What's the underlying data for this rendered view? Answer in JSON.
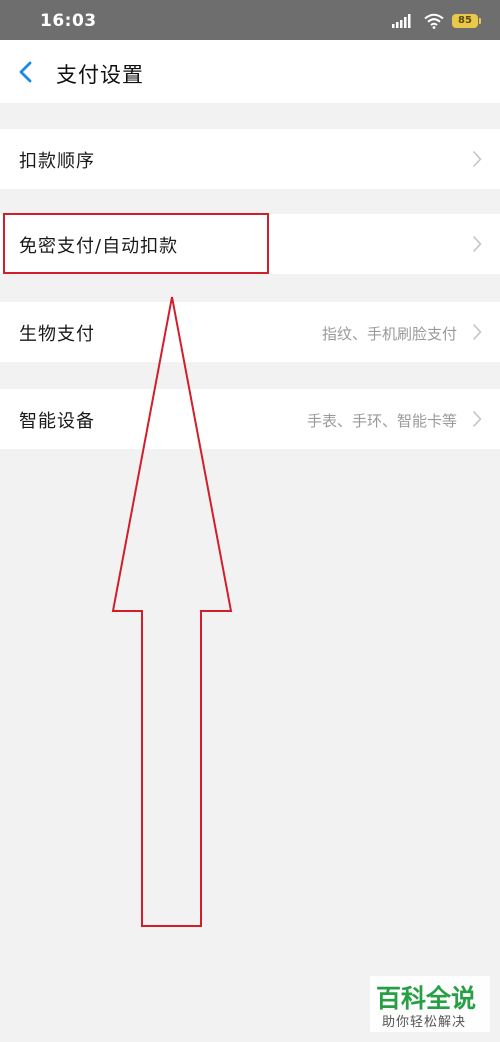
{
  "status_bar": {
    "time": "16:03",
    "battery_level": "85",
    "icons": [
      "signal-icon",
      "wifi-icon",
      "battery-icon"
    ]
  },
  "nav": {
    "back_icon": "chevron-left-icon",
    "title": "支付设置"
  },
  "settings": [
    {
      "label": "扣款顺序",
      "value": ""
    },
    {
      "label": "免密支付/自动扣款",
      "value": ""
    },
    {
      "label": "生物支付",
      "value": "指纹、手机刷脸支付"
    },
    {
      "label": "智能设备",
      "value": "手表、手环、智能卡等"
    }
  ],
  "annotation": {
    "highlighted_item": "免密支付/自动扣款",
    "color": "#d11e2a"
  },
  "watermark": {
    "logo": "百科全说",
    "tagline": "助你轻松解决",
    "color": "#27a045"
  },
  "colors": {
    "accent": "#1e88e5",
    "background": "#f2f2f2",
    "status_bar": "#6e6e6e"
  }
}
